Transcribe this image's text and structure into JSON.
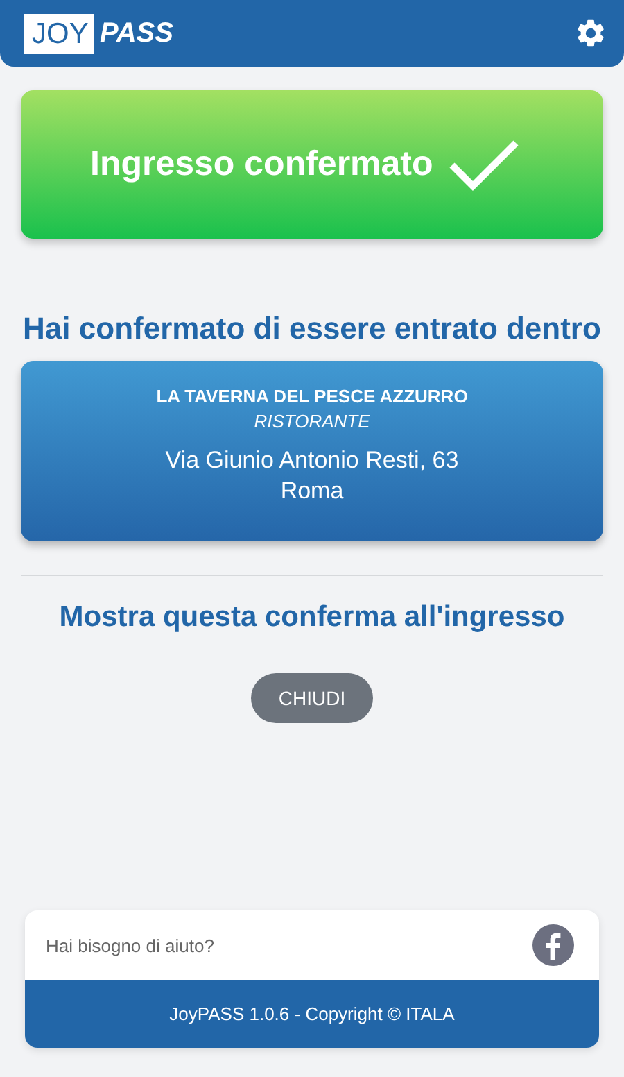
{
  "header": {
    "logo": {
      "part_1": "JOY",
      "part_2": "PASS"
    }
  },
  "status_card": {
    "title": "Ingresso confermato"
  },
  "message": "Hai confermato di essere entrato dentro",
  "venue": {
    "name": "LA TAVERNA DEL PESCE AZZURRO",
    "category": "RISTORANTE",
    "address": "Via Giunio Antonio Resti, 63",
    "city": "Roma"
  },
  "instruction": "Mostra questa conferma all'ingresso",
  "close_button": "CHIUDI",
  "footer": {
    "help": "Hai bisogno di aiuto?",
    "copyright": "JoyPASS 1.0.6 - Copyright © ITALA"
  }
}
